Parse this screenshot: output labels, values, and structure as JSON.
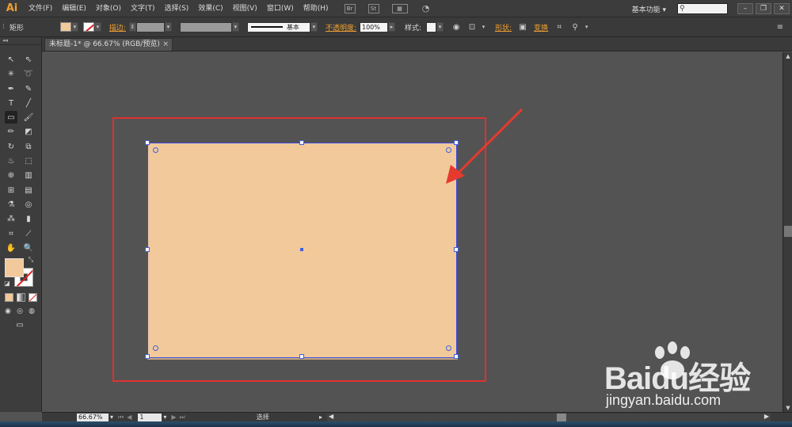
{
  "app": {
    "logo": "Ai",
    "menu": [
      "文件(F)",
      "编辑(E)",
      "对象(O)",
      "文字(T)",
      "选择(S)",
      "效果(C)",
      "视图(V)",
      "窗口(W)",
      "帮助(H)"
    ],
    "bridge_icon": "Br",
    "stock_icon": "St",
    "workspace_label": "基本功能",
    "search_icon": "search-icon",
    "window_buttons": [
      "–",
      "❐",
      "✕"
    ]
  },
  "control_bar": {
    "object_type": "矩形",
    "stroke_link": "描边",
    "stroke_style": "基本",
    "opacity_link": "不透明度",
    "opacity_value": "100%",
    "style_label": "样式",
    "shape_link": "形状",
    "transform_link": "变换",
    "fill_color": "#f1c99a",
    "stroke_color": "none"
  },
  "document": {
    "tab_title": "未标题-1* @ 66.67% (RGB/预览)",
    "tab_close": "×"
  },
  "canvas": {
    "rect_fill": "#f1c99a",
    "selection_color": "#4060e0",
    "highlight_color": "#e03030"
  },
  "status_bar": {
    "zoom": "66.67%",
    "page": "1",
    "status_text": "选择"
  },
  "watermark": {
    "brand": "Baidu经验",
    "url": "jingyan.baidu.com"
  }
}
